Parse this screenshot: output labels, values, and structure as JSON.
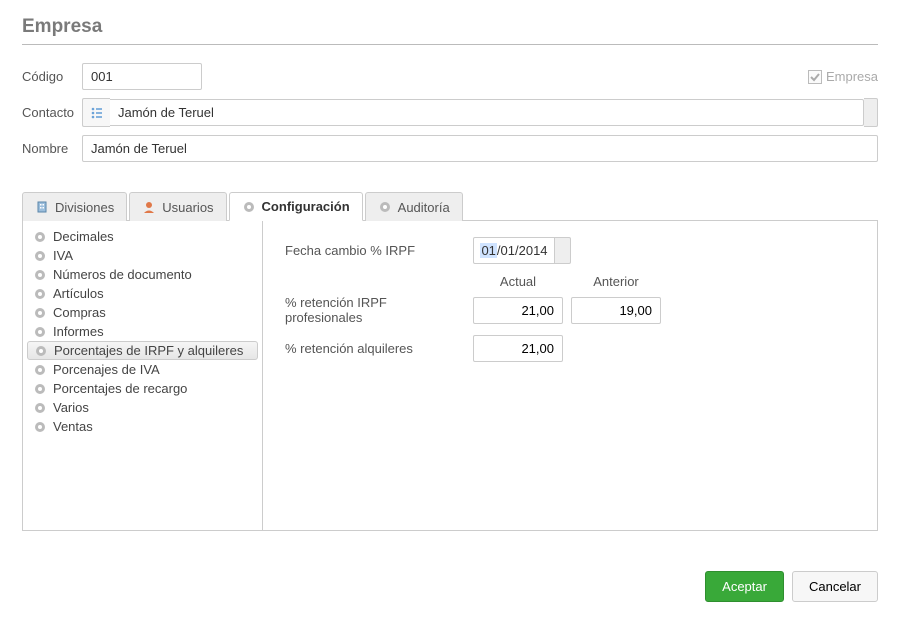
{
  "title": "Empresa",
  "labels": {
    "codigo": "Código",
    "contacto": "Contacto",
    "nombre": "Nombre",
    "empresa": "Empresa"
  },
  "fields": {
    "codigo": "001",
    "contacto": "Jamón de Teruel",
    "nombre": "Jamón de Teruel",
    "empresa_checked": true
  },
  "tabs": [
    {
      "label": "Divisiones",
      "icon": "building-icon"
    },
    {
      "label": "Usuarios",
      "icon": "user-icon"
    },
    {
      "label": "Configuración",
      "icon": "gear-icon"
    },
    {
      "label": "Auditoría",
      "icon": "gear-icon"
    }
  ],
  "activeTab": 2,
  "config_sidebar": {
    "items": [
      "Decimales",
      "IVA",
      "Números de documento",
      "Artículos",
      "Compras",
      "Informes",
      "Porcentajes de IRPF y alquileres",
      "Porcenajes de IVA",
      "Porcentajes de recargo",
      "Varios",
      "Ventas"
    ],
    "selected": 6
  },
  "config_panel": {
    "fecha_label": "Fecha cambio % IRPF",
    "fecha_value_sel": "01",
    "fecha_value_rest": "/01/2014",
    "col_actual": "Actual",
    "col_anterior": "Anterior",
    "ret_prof_label": "% retención IRPF profesionales",
    "ret_prof_actual": "21,00",
    "ret_prof_anterior": "19,00",
    "ret_alq_label": "% retención alquileres",
    "ret_alq_actual": "21,00"
  },
  "buttons": {
    "accept": "Aceptar",
    "cancel": "Cancelar"
  }
}
